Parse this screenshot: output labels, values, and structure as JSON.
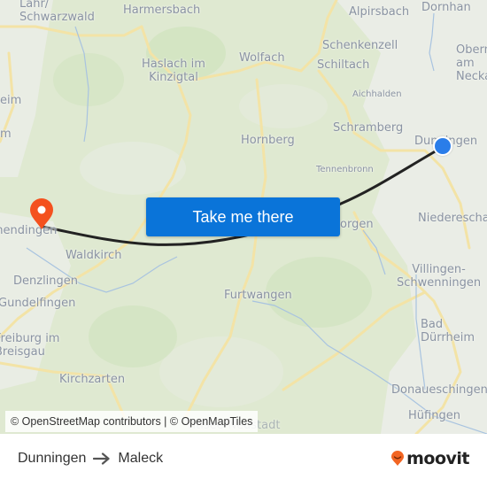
{
  "map": {
    "places": [
      {
        "name": "Lahr/\nSchwarzwald",
        "id": "lahr"
      },
      {
        "name": "Harmersbach",
        "id": "harmersbach"
      },
      {
        "name": "Alpirsbach",
        "id": "alpirsbach"
      },
      {
        "name": "Dornhan",
        "id": "dornhan"
      },
      {
        "name": "Schenkenzell",
        "id": "schenkenzell"
      },
      {
        "name": "Haslach im\nKinzigtal",
        "id": "haslach"
      },
      {
        "name": "Wolfach",
        "id": "wolfach"
      },
      {
        "name": "Schiltach",
        "id": "schiltach"
      },
      {
        "name": "Oberndorf\nam Neckar",
        "id": "oberndorf"
      },
      {
        "name": "eim",
        "id": "eim"
      },
      {
        "name": "Aichhalden",
        "id": "aichhalden"
      },
      {
        "name": "m",
        "id": "m"
      },
      {
        "name": "Schramberg",
        "id": "schramberg"
      },
      {
        "name": "Hornberg",
        "id": "hornberg"
      },
      {
        "name": "Dunningen",
        "id": "dunningen"
      },
      {
        "name": "Tennenbronn",
        "id": "tennenbronn"
      },
      {
        "name": "Niedereschach",
        "id": "niedereschach"
      },
      {
        "name": "orgen",
        "id": "orgen"
      },
      {
        "name": "Emmendingen",
        "id": "emmendingen"
      },
      {
        "name": "Waldkirch",
        "id": "waldkirch"
      },
      {
        "name": "Villingen-\nSchwenningen",
        "id": "villingen"
      },
      {
        "name": "Denzlingen",
        "id": "denzlingen"
      },
      {
        "name": "Furtwangen",
        "id": "furtwangen"
      },
      {
        "name": "Gundelfingen",
        "id": "gundelfingen"
      },
      {
        "name": "Bad Dürrheim",
        "id": "badduerrheim"
      },
      {
        "name": "Freiburg im\nBreisgau",
        "id": "freiburg"
      },
      {
        "name": "Kirchzarten",
        "id": "kirchzarten"
      },
      {
        "name": "Donaueschingen",
        "id": "donaueschingen"
      },
      {
        "name": "Hüfingen",
        "id": "huefingen"
      },
      {
        "name": "Titisee-Neustadt",
        "id": "titisee"
      }
    ],
    "origin_icon": "origin-dot-icon",
    "destination_icon": "destination-pin-icon",
    "route_color": "#222222",
    "origin_color": "#2a7de9",
    "destination_color": "#f4511e"
  },
  "cta": {
    "label": "Take me there",
    "color": "#0a74d9"
  },
  "attribution": "© OpenStreetMap contributors | © OpenMapTiles",
  "footer": {
    "from": "Dunningen",
    "to": "Maleck",
    "arrow_icon": "arrow-right-icon",
    "brand": "moovit",
    "brand_color": "#f26522"
  }
}
